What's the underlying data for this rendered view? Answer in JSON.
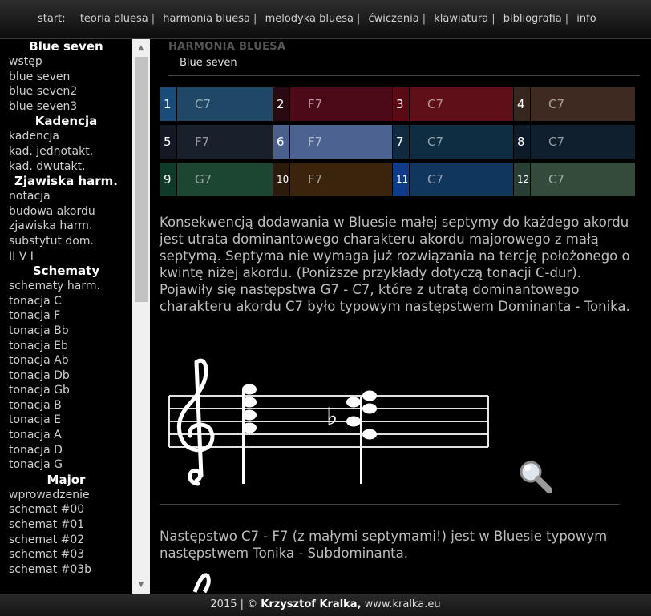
{
  "nav": {
    "start": "start:",
    "items": [
      "teoria bluesa",
      "harmonia bluesa",
      "melodyka bluesa",
      "ćwiczenia",
      "klawiatura",
      "bibliografia",
      "info"
    ],
    "separator": "|"
  },
  "sidebar": {
    "groups": [
      {
        "heading": "Blue seven",
        "links": [
          "wstęp",
          "blue seven",
          "blue seven2",
          "blue seven3"
        ]
      },
      {
        "heading": "Kadencja",
        "links": [
          "kadencja",
          "kad. jednotakt.",
          "kad. dwutakt."
        ]
      },
      {
        "heading": "Zjawiska harm.",
        "links": [
          "notacja",
          "budowa akordu",
          "zjawiska harm.",
          "substytut dom.",
          "II V I"
        ]
      },
      {
        "heading": "Schematy",
        "links": [
          "schematy harm.",
          "tonacja C",
          "tonacja F",
          "tonacja Bb",
          "tonacja Eb",
          "tonacja Ab",
          "tonacja Db",
          "tonacja Gb",
          "tonacja B",
          "tonacja E",
          "tonacja A",
          "tonacja D",
          "tonacja G"
        ]
      },
      {
        "heading": "Major",
        "links": [
          "wprowadzenie",
          "schemat #00",
          "schemat #01",
          "schemat #02",
          "schemat #03",
          "schemat #03b"
        ]
      }
    ]
  },
  "content": {
    "section_title": "HARMONIA BLUESA",
    "subtitle": "Blue seven",
    "grid": [
      {
        "num": "1",
        "chord": "C7",
        "num_color": "#1a4c7a",
        "chord_color": "#1f4866"
      },
      {
        "num": "2",
        "chord": "F7",
        "num_color": "#2a0a12",
        "chord_color": "#4c0a18"
      },
      {
        "num": "3",
        "chord": "C7",
        "num_color": "#5a0a12",
        "chord_color": "#5e0f18"
      },
      {
        "num": "4",
        "chord": "C7",
        "num_color": "#35261e",
        "chord_color": "#3f2a22"
      },
      {
        "num": "5",
        "chord": "F7",
        "num_color": "#141824",
        "chord_color": "#1a1f2c"
      },
      {
        "num": "6",
        "chord": "F7",
        "num_color": "#4a5f8c",
        "chord_color": "#4c6290"
      },
      {
        "num": "7",
        "chord": "C7",
        "num_color": "#0f2b3f",
        "chord_color": "#0f2d42"
      },
      {
        "num": "8",
        "chord": "C7",
        "num_color": "#0d1b28",
        "chord_color": "#0f1f2e"
      },
      {
        "num": "9",
        "chord": "G7",
        "num_color": "#0e3a2a",
        "chord_color": "#1c4632"
      },
      {
        "num": "10",
        "chord": "F7",
        "num_color": "#2c1a0a",
        "chord_color": "#3a240c"
      },
      {
        "num": "11",
        "chord": "C7",
        "num_color": "#0e3c8a",
        "chord_color": "#10365e"
      },
      {
        "num": "12",
        "chord": "C7",
        "num_color": "#283e30",
        "chord_color": "#344a3a"
      }
    ],
    "para1": "Konsekwencją dodawania w Bluesie małej septymy do każdego akordu jest utrata dominantowego charakteru akordu majorowego z małą septymą. Septyma nie wymaga już rozwiązania na tercję położonego o kwintę niżej akordu. (Poniższe przykłady dotyczą tonacji C-dur).",
    "para2": "Pojawiły się następstwa G7 - C7, które z utratą dominantowego charakteru akordu C7 było typowym następstwem Dominanta - Tonika.",
    "para3": "Następstwo C7 - F7 (z małymi septymami!) jest w Bluesie typowym następstwem Tonika - Subdominanta."
  },
  "footer": {
    "year": "2015 | © ",
    "author": "Krzysztof Kralka,",
    "site": " www.kralka.eu"
  }
}
